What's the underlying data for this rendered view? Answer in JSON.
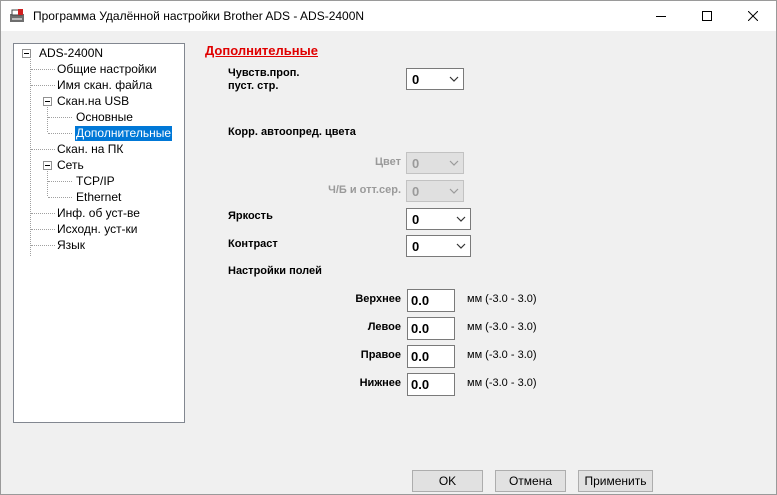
{
  "window": {
    "title": "Программа Удалённой настройки Brother ADS - ADS-2400N"
  },
  "tree": {
    "items": [
      {
        "label": "ADS-2400N"
      },
      {
        "label": "Общие настройки"
      },
      {
        "label": "Имя скан. файла"
      },
      {
        "label": "Скан.на USB"
      },
      {
        "label": "Основные"
      },
      {
        "label": "Дополнительные"
      },
      {
        "label": "Скан. на ПК"
      },
      {
        "label": "Сеть"
      },
      {
        "label": "TCP/IP"
      },
      {
        "label": "Ethernet"
      },
      {
        "label": "Инф. об уст-ве"
      },
      {
        "label": "Исходн. уст-ки"
      },
      {
        "label": "Язык"
      }
    ],
    "selected": "Дополнительные"
  },
  "main": {
    "section_title": "Дополнительные",
    "blank_page_sensitivity": {
      "label": "Чувств.проп. пуст. стр.",
      "value": "0"
    },
    "color_correction_heading": "Корр. автоопред. цвета",
    "color": {
      "label": "Цвет",
      "value": "0"
    },
    "bw_gray": {
      "label": "Ч/Б и отт.сер.",
      "value": "0"
    },
    "brightness": {
      "label": "Яркость",
      "value": "0"
    },
    "contrast": {
      "label": "Контраст",
      "value": "0"
    },
    "margins_heading": "Настройки полей",
    "margins": [
      {
        "label": "Верхнее",
        "value": "0.0",
        "unit": "мм (-3.0 - 3.0)"
      },
      {
        "label": "Левое",
        "value": "0.0",
        "unit": "мм (-3.0 - 3.0)"
      },
      {
        "label": "Правое",
        "value": "0.0",
        "unit": "мм (-3.0 - 3.0)"
      },
      {
        "label": "Нижнее",
        "value": "0.0",
        "unit": "мм (-3.0 - 3.0)"
      }
    ]
  },
  "buttons": {
    "ok": "OK",
    "cancel": "Отмена",
    "apply": "Применить"
  },
  "colors": {
    "selection": "#0078d7",
    "section_title": "#e00000"
  }
}
